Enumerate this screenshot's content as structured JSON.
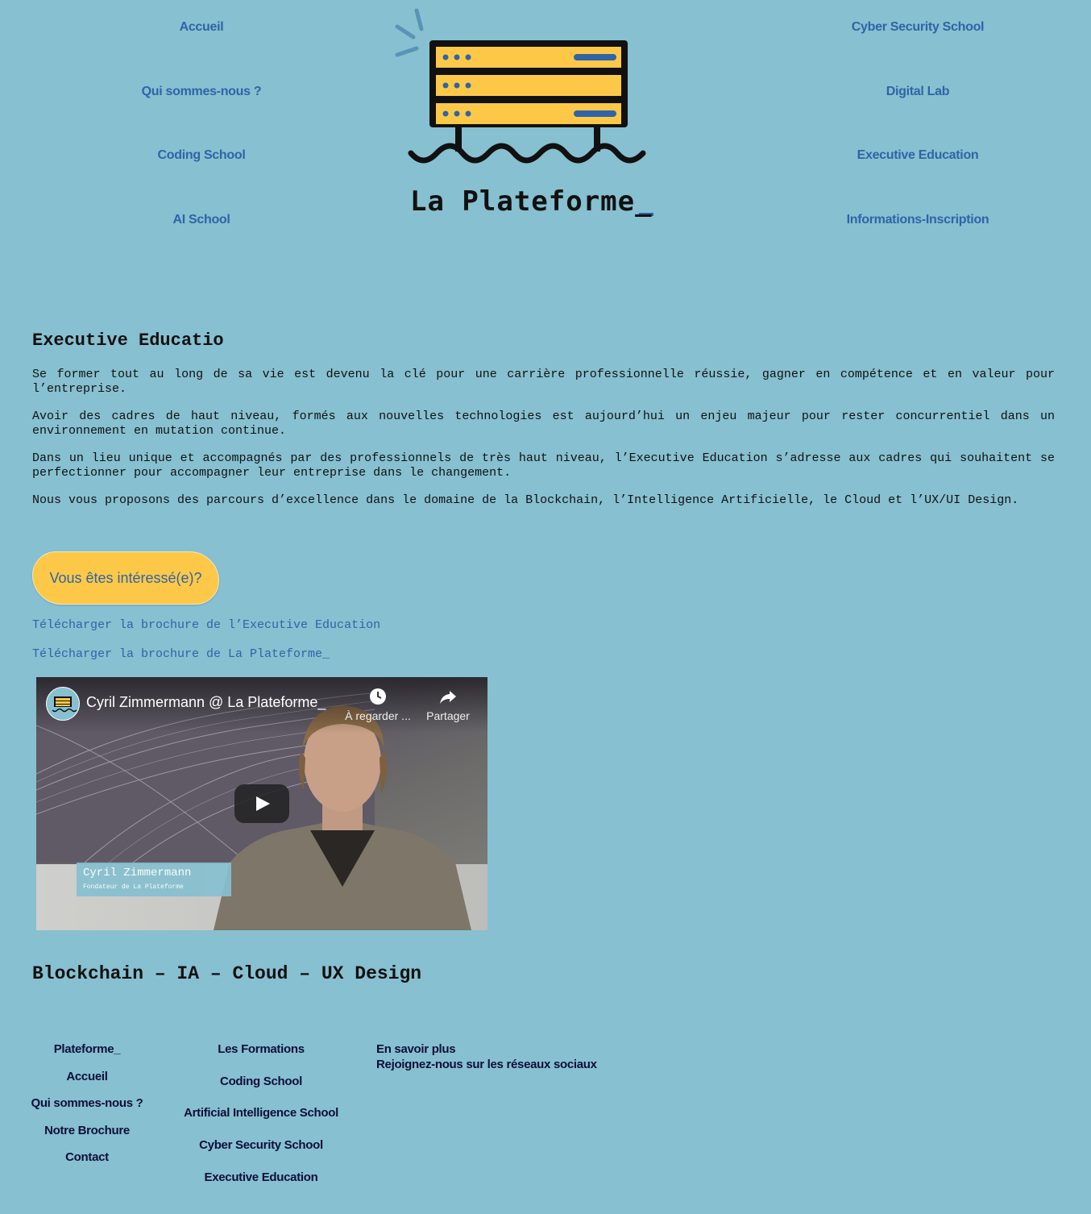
{
  "header": {
    "nav_left": [
      "Accueil",
      "Qui sommes-nous ?",
      "Coding School",
      "AI School"
    ],
    "nav_right": [
      "Cyber Security School",
      "Digital Lab",
      "Executive Education",
      "Informations-Inscription"
    ],
    "logo_text": "La Plateforme_"
  },
  "main": {
    "heading": "Executive Educatio",
    "paragraphs": [
      "Se former tout au long de sa vie est devenu la clé pour une carrière professionnelle réussie, gagner en compétence et en valeur pour l’entreprise.",
      "Avoir des cadres de haut niveau, formés aux nouvelles technologies est aujourd’hui un enjeu majeur pour rester concurrentiel dans un environnement en mutation continue.",
      "Dans un lieu unique et accompagnés par des professionnels de très haut niveau, l’Executive Education s’adresse aux cadres qui souhaitent se perfectionner pour accompagner leur entreprise dans le changement.",
      "Nous vous proposons des parcours d’excellence dans le domaine de la Blockchain, l’Intelligence Artificielle, le Cloud et l’UX/UI Design."
    ],
    "cta_label": "Vous êtes intéressé(e)?",
    "brochure_exec": "Télécharger la brochure de l’Executive Education",
    "brochure_plateforme": "Télécharger la brochure de La Plateforme_",
    "topics": "Blockchain – IA – Cloud – UX Design"
  },
  "video": {
    "title": "Cyril Zimmermann @ La Plateforme_",
    "watch_later": "À regarder ...",
    "share": "Partager",
    "lower_third_name": "Cyril Zimmermann",
    "lower_third_role": "Fondateur de La Plateforme"
  },
  "footer": {
    "col1": [
      "Plateforme_",
      "Accueil",
      "Qui sommes-nous ?",
      "Notre Brochure",
      "Contact"
    ],
    "col2": [
      "Les Formations",
      "Coding School",
      "Artificial Intelligence School",
      "Cyber Security School",
      "Executive Education"
    ],
    "col3": [
      "En savoir plus",
      "Rejoignez-nous sur les réseaux sociaux"
    ]
  },
  "colors": {
    "background": "#87c0d0",
    "link": "#2f64a8",
    "accent_yellow": "#fdc848",
    "text_dark": "#111111"
  }
}
